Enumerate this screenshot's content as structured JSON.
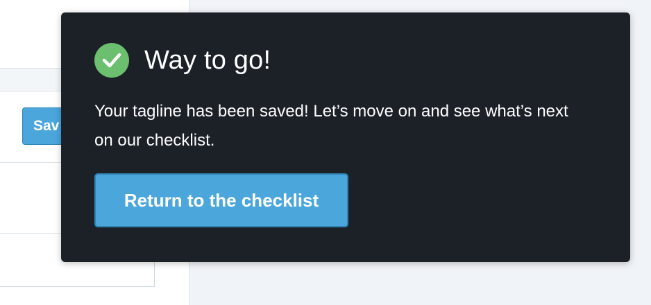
{
  "background": {
    "save_button_label": "Sav"
  },
  "popover": {
    "icon": "checkmark-circle-icon",
    "icon_color": "#6bbf6f",
    "title": "Way to go!",
    "message": "Your tagline has been saved! Let’s move on and see what’s next on our checklist.",
    "button_label": "Return to the checklist",
    "button_color": "#4aa6db",
    "background_color": "#1c2128"
  }
}
